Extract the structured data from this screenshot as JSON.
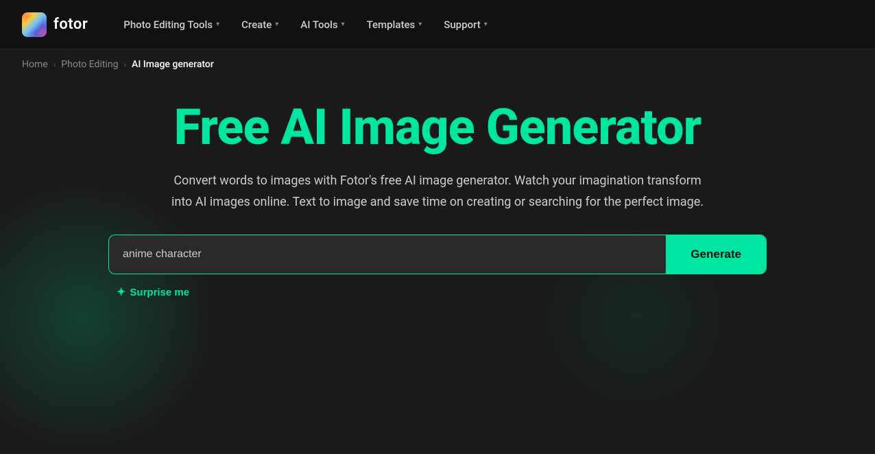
{
  "logo": {
    "text": "fotor",
    "icon_label": "fotor-logo-icon"
  },
  "navbar": {
    "items": [
      {
        "label": "Photo Editing Tools",
        "has_dropdown": true
      },
      {
        "label": "Create",
        "has_dropdown": true
      },
      {
        "label": "AI Tools",
        "has_dropdown": true
      },
      {
        "label": "Templates",
        "has_dropdown": true
      },
      {
        "label": "Support",
        "has_dropdown": true
      }
    ]
  },
  "breadcrumb": {
    "items": [
      {
        "label": "Home",
        "active": false
      },
      {
        "label": "Photo Editing",
        "active": false
      },
      {
        "label": "AI Image generator",
        "active": true
      }
    ]
  },
  "hero": {
    "title": "Free AI Image Generator",
    "description": "Convert words to images with Fotor's free AI image generator. Watch your imagination transform into AI images online. Text to image and save time on creating or searching for the perfect image."
  },
  "search": {
    "placeholder": "anime character",
    "value": "anime character",
    "generate_label": "Generate",
    "surprise_label": "Surprise me"
  }
}
